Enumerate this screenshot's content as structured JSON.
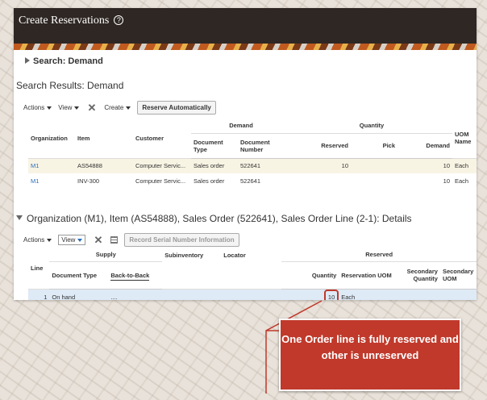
{
  "header": {
    "title": "Create Reservations",
    "help_glyph": "?"
  },
  "search": {
    "label": "Search: Demand"
  },
  "results": {
    "title": "Search Results: Demand",
    "toolbar": {
      "actions": "Actions",
      "view": "View",
      "create": "Create",
      "reserve_auto": "Reserve Automatically"
    },
    "group_headers": {
      "demand": "Demand",
      "quantity": "Quantity"
    },
    "columns": {
      "organization": "Organization",
      "item": "Item",
      "customer": "Customer",
      "document_type": "Document Type",
      "document_number": "Document Number",
      "reserved": "Reserved",
      "pick": "Pick",
      "demand": "Demand",
      "uom_name": "UOM Name"
    },
    "rows": [
      {
        "organization": "M1",
        "item": "AS54888",
        "customer": "Computer Servic...",
        "document_type": "Sales order",
        "document_number": "522641",
        "reserved": "10",
        "pick": "",
        "demand": "10",
        "uom": "Each"
      },
      {
        "organization": "M1",
        "item": "INV-300",
        "customer": "Computer Servic...",
        "document_type": "Sales order",
        "document_number": "522641",
        "reserved": "",
        "pick": "",
        "demand": "10",
        "uom": "Each"
      }
    ]
  },
  "details": {
    "title": "Organization (M1), Item (AS54888), Sales Order (522641), Sales Order Line (2-1): Details",
    "toolbar": {
      "actions": "Actions",
      "view": "View",
      "record_serial": "Record Serial Number Information"
    },
    "group_headers": {
      "supply": "Supply",
      "reserved": "Reserved"
    },
    "columns": {
      "line": "Line",
      "document_type": "Document Type",
      "back_to_back": "Back-to-Back",
      "subinventory": "Subinventory",
      "locator": "Locator",
      "quantity": "Quantity",
      "reservation_uom": "Reservation UOM",
      "secondary_quantity": "Secondary Quantity",
      "secondary_uom": "Secondary UOM"
    },
    "rows": [
      {
        "line": "1",
        "document_type": "On hand",
        "back_to_back": "....",
        "subinventory": "",
        "locator": "",
        "quantity": "10",
        "reservation_uom": "Each",
        "secondary_quantity": "",
        "secondary_uom": ""
      }
    ]
  },
  "callout": {
    "text": "One Order line is fully reserved and other is unreserved",
    "color": "#c0392b"
  },
  "colors": {
    "header_bg": "#2f2724",
    "link": "#2a6ebb",
    "selected_row": "#deeaf6"
  }
}
